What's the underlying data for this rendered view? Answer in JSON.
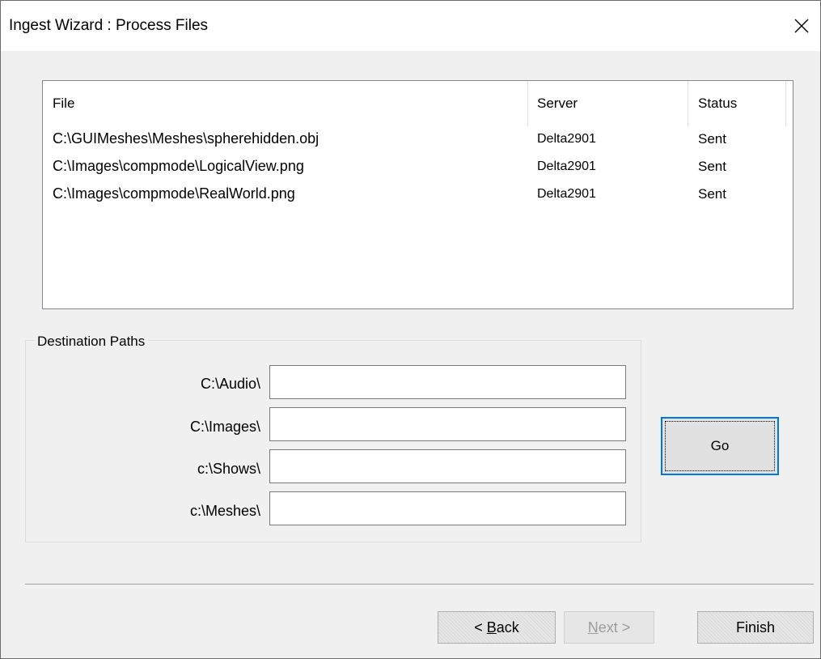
{
  "window": {
    "title": "Ingest Wizard : Process Files"
  },
  "files_table": {
    "columns": [
      "File",
      "Server",
      "Status"
    ],
    "rows": [
      {
        "file": "C:\\GUIMeshes\\Meshes\\spherehidden.obj",
        "server": "Delta2901",
        "status": "Sent"
      },
      {
        "file": "C:\\Images\\compmode\\LogicalView.png",
        "server": "Delta2901",
        "status": "Sent"
      },
      {
        "file": "C:\\Images\\compmode\\RealWorld.png",
        "server": "Delta2901",
        "status": "Sent"
      }
    ]
  },
  "destination": {
    "legend": "Destination Paths",
    "paths": [
      {
        "label": "C:\\Audio\\",
        "value": ""
      },
      {
        "label": "C:\\Images\\",
        "value": ""
      },
      {
        "label": "c:\\Shows\\",
        "value": ""
      },
      {
        "label": "c:\\Meshes\\",
        "value": ""
      }
    ]
  },
  "buttons": {
    "go": "Go",
    "back_prefix": "< ",
    "back_mnemonic": "B",
    "back_rest": "ack",
    "next_mnemonic": "N",
    "next_rest": "ext >",
    "finish": "Finish"
  },
  "colors": {
    "focus_border": "#0078d7",
    "window_bg": "#f0f0f0"
  }
}
